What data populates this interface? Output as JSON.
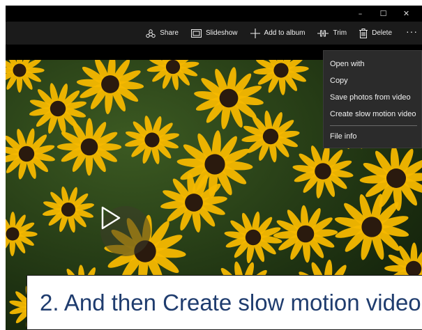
{
  "window_controls": {
    "minimize": "–",
    "maximize": "☐",
    "close": "✕"
  },
  "toolbar": {
    "share_label": "Share",
    "slideshow_label": "Slideshow",
    "add_to_album_label": "Add to album",
    "trim_label": "Trim",
    "delete_label": "Delete",
    "more_label": "···"
  },
  "context_menu": {
    "items": [
      "Open with",
      "Copy",
      "Save photos from video",
      "Create slow motion video",
      "File info"
    ]
  },
  "caption": {
    "text": "2. And then Create slow motion video"
  },
  "colors": {
    "toolbar_bg": "#1b1b1b",
    "menu_bg": "#2b2b2b",
    "caption_text": "#1f3c6e",
    "petal": "#f5b800",
    "flower_center": "#2a1a0e"
  }
}
